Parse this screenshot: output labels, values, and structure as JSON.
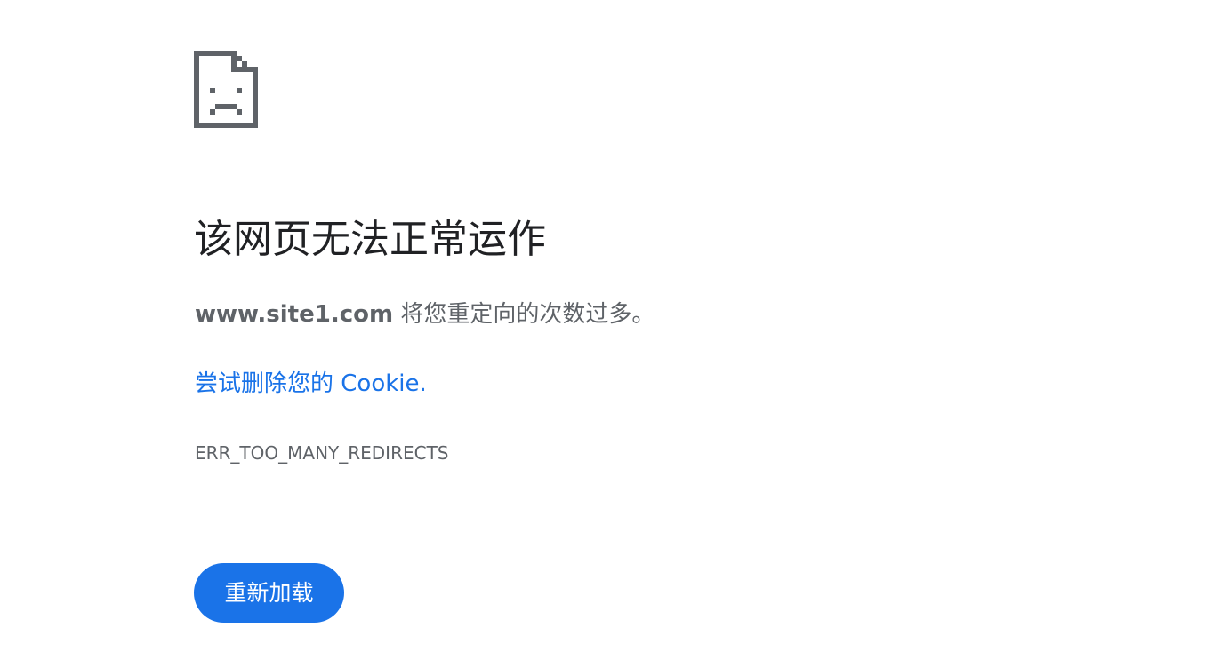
{
  "error": {
    "icon": "sad-page-icon",
    "heading": "该网页无法正常运作",
    "summary_host": "www.site1.com",
    "summary_text": " 将您重定向的次数过多。",
    "suggestion_link": "尝试删除您的 Cookie.",
    "code": "ERR_TOO_MANY_REDIRECTS"
  },
  "actions": {
    "reload_label": "重新加载"
  },
  "colors": {
    "icon": "#5f6368",
    "heading": "#202124",
    "body_text": "#5f6368",
    "link": "#1a73e8",
    "button_background": "#1a73e8",
    "button_text": "#ffffff"
  }
}
